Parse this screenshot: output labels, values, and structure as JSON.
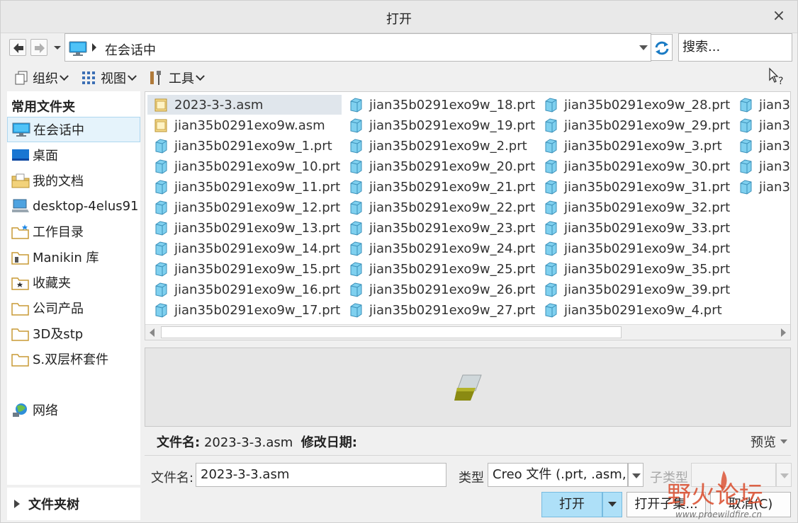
{
  "window": {
    "title": "打开",
    "close_symbol": "×"
  },
  "address": {
    "location": "在会话中"
  },
  "search": {
    "placeholder": "搜索..."
  },
  "toolbar": {
    "organize": "组织",
    "view": "视图",
    "tools": "工具"
  },
  "sidebar": {
    "header": "常用文件夹",
    "items": [
      {
        "label": "在会话中",
        "icon": "monitor-icon",
        "selected": true
      },
      {
        "label": "桌面",
        "icon": "desktop-icon"
      },
      {
        "label": "我的文档",
        "icon": "documents-icon"
      },
      {
        "label": "desktop-4elus91",
        "icon": "computer-icon"
      },
      {
        "label": "工作目录",
        "icon": "working-folder-icon"
      },
      {
        "label": "Manikin 库",
        "icon": "library-folder-icon"
      },
      {
        "label": "收藏夹",
        "icon": "favorites-icon"
      },
      {
        "label": "公司产品",
        "icon": "folder-icon"
      },
      {
        "label": "3D及stp",
        "icon": "folder-icon"
      },
      {
        "label": "S.双层杯套件",
        "icon": "folder-icon"
      },
      {
        "label": "网络",
        "icon": "network-icon"
      }
    ],
    "tree_label": "文件夹树"
  },
  "files": {
    "columns": [
      [
        {
          "name": "2023-3-3.asm",
          "type": "asm",
          "selected": true
        },
        {
          "name": "jian35b0291exo9w.asm",
          "type": "asm"
        },
        {
          "name": "jian35b0291exo9w_1.prt",
          "type": "prt"
        },
        {
          "name": "jian35b0291exo9w_10.prt",
          "type": "prt"
        },
        {
          "name": "jian35b0291exo9w_11.prt",
          "type": "prt"
        },
        {
          "name": "jian35b0291exo9w_12.prt",
          "type": "prt"
        },
        {
          "name": "jian35b0291exo9w_13.prt",
          "type": "prt"
        },
        {
          "name": "jian35b0291exo9w_14.prt",
          "type": "prt"
        },
        {
          "name": "jian35b0291exo9w_15.prt",
          "type": "prt"
        },
        {
          "name": "jian35b0291exo9w_16.prt",
          "type": "prt"
        },
        {
          "name": "jian35b0291exo9w_17.prt",
          "type": "prt"
        }
      ],
      [
        {
          "name": "jian35b0291exo9w_18.prt",
          "type": "prt"
        },
        {
          "name": "jian35b0291exo9w_19.prt",
          "type": "prt"
        },
        {
          "name": "jian35b0291exo9w_2.prt",
          "type": "prt"
        },
        {
          "name": "jian35b0291exo9w_20.prt",
          "type": "prt"
        },
        {
          "name": "jian35b0291exo9w_21.prt",
          "type": "prt"
        },
        {
          "name": "jian35b0291exo9w_22.prt",
          "type": "prt"
        },
        {
          "name": "jian35b0291exo9w_23.prt",
          "type": "prt"
        },
        {
          "name": "jian35b0291exo9w_24.prt",
          "type": "prt"
        },
        {
          "name": "jian35b0291exo9w_25.prt",
          "type": "prt"
        },
        {
          "name": "jian35b0291exo9w_26.prt",
          "type": "prt"
        },
        {
          "name": "jian35b0291exo9w_27.prt",
          "type": "prt"
        }
      ],
      [
        {
          "name": "jian35b0291exo9w_28.prt",
          "type": "prt"
        },
        {
          "name": "jian35b0291exo9w_29.prt",
          "type": "prt"
        },
        {
          "name": "jian35b0291exo9w_3.prt",
          "type": "prt"
        },
        {
          "name": "jian35b0291exo9w_30.prt",
          "type": "prt"
        },
        {
          "name": "jian35b0291exo9w_31.prt",
          "type": "prt"
        },
        {
          "name": "jian35b0291exo9w_32.prt",
          "type": "prt"
        },
        {
          "name": "jian35b0291exo9w_33.prt",
          "type": "prt"
        },
        {
          "name": "jian35b0291exo9w_34.prt",
          "type": "prt"
        },
        {
          "name": "jian35b0291exo9w_35.prt",
          "type": "prt"
        },
        {
          "name": "jian35b0291exo9w_39.prt",
          "type": "prt"
        },
        {
          "name": "jian35b0291exo9w_4.prt",
          "type": "prt"
        }
      ],
      [
        {
          "name": "jian3",
          "type": "prt"
        },
        {
          "name": "jian3",
          "type": "prt"
        },
        {
          "name": "jian3",
          "type": "prt"
        },
        {
          "name": "jian3",
          "type": "prt"
        },
        {
          "name": "jian3",
          "type": "prt"
        }
      ]
    ]
  },
  "info": {
    "filename_label": "文件名:",
    "filename_value": "2023-3-3.asm",
    "modified_label": "修改日期:",
    "preview_toggle": "预览"
  },
  "bottom": {
    "filename_label": "文件名:",
    "filename_value": "2023-3-3.asm",
    "type_label": "类型",
    "type_value": "Creo 文件 (.prt, .asm, .",
    "subtype_label": "子类型",
    "open_button": "打开",
    "open_subset_button": "打开子集...",
    "cancel_button": "取消(C)"
  },
  "watermark": {
    "text": "野火论坛",
    "url": "www.proewildfire.cn"
  },
  "colors": {
    "selection": "#e5f3fb",
    "primary_button": "#aee0f8",
    "part_icon": "#7fd0ef",
    "asm_icon": "#f0c860",
    "watermark": "#d94a2a"
  }
}
